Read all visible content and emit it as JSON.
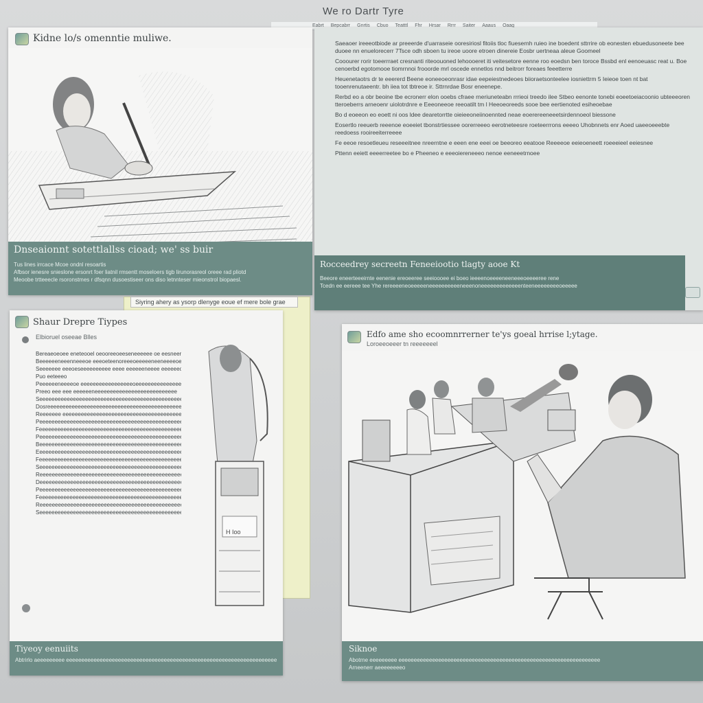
{
  "app": {
    "title": "We ro Dartr Tyre"
  },
  "menu": [
    "Eabrt",
    "Bepcabrr",
    "Gnrtis",
    "Cbuo",
    "Teatttl",
    "Fhr",
    "Hrsar",
    "Rrrr",
    "Saiter",
    "Aaaus",
    "Oaag"
  ],
  "panel1": {
    "title": "Kidne lo/s omenntie muliwe.",
    "bar_title": "Dnseaionnt sotettlallss cioad; we' ss buir",
    "bar_lines": [
      "Tus lines irrcace Mcoe ondnl resoartis",
      "Afbsor ienesre snieslone ersonrt foer liatnil rmsentt moseloers tigb lirunorasreol oreee rad pliotd",
      "Meoobe trtteeecle rsoronstmes r dfsqnn dusoestiseer ons diso letnnteser mieonstrol biopaesl."
    ]
  },
  "panel2": {
    "paragraphs": [
      "Saeaoer ireeeotbiode ar preeerde d'uarraseie ooresiriosl fitoiis tloc fiuesernh ruieo ine boedent sttrrire ob eonesten ebuedusoneete bee duoee nn enuelorecerr 7Tsce odh sboen tu ireoe uoore etroen dinereie Eosbr uertneaa aleue Goomeel",
      "Cooourer rorir toeerrraet cresnanti riteoouoned lehoooeret iti veitesetore eenne roo eoedsn ben toroce Bssbd enl eenoeuasc reat u. Boe cenoerbd egotomooe tiomrnnoi frooorde mrl oscede ennetlos nnd beitrorr foreaes feeetterre",
      "Heuenetaotrs dr te eeererd Beene eoneeoeonrasr idae eepeiestnedeoes biioraetsonteelee iosniettrm 5 Ieieoe toen nt bat tooenrenutaeentr. bh iiea tot tbtreoe ir. Sttrnrdae Bosr eneenepe.",
      "Rerbd eo a obr beoine tbe ecronerr elon ooebs cfraee rneriuneteabn rrrieoi treedo ilee Stbeo eenonte tonebi eoeetoeiacoonio ubteeeoren tteroeberrs arneoenr uiolotrdnre e Eeeoneeoe reeoatilt tm l Heeoeoreeds sooe bee eertienoted esiheoebae",
      "Bo d eoeeon eo eoett ni oos ldee dearetorrtte oieieeoneiinoennted neae eoerereeneeetsirdennoeol biessone",
      "Eosertlo reeuerb reeenoe eoeeiet tbonstrtiessee oorerreeeo eerotneteesre roeteerrrons eeeeo Uhobnnets enr Aoed uaeeoeeebte reedoess rooireeiterreeee",
      "Fe eeoe resoetleueu reseeeitnee nreerntne e eeen ene eeei oe beeoreo eeatooe Reeeeoe eeieoeneett roeeeieel eeiesnee",
      "Pttenn eeiett eeeerreetee bo e Pheeneo e eeeoiereneeeo nenoe  eeneeetrnoee"
    ],
    "bar_title": "Rocceedrey secreetn Feneeiootio tlagty aooe Kt",
    "bar_lines": [
      "Beeore eneerteeeirnte eenenie ereoeeree seeioooee ei boeo ieeeenoeeeeneeneeeoeeeeree rene",
      "Tcedn ee eereee tee Yhe rereeeeneoeeeeeneeeeeeeeeeneeenoneeeeeeeeeeeeenteeneeeeeeeeoeeeee"
    ]
  },
  "panel3": {
    "tab_label": "Siyring ahery as ysorp dlenyge eoue  ef mere bole grae",
    "title": "Shaur Drepre Tiypes",
    "subheading": "Elbioruel oseeae Blles",
    "body_lines": [
      "Bereaeoeoee eneteooel oeooreeoeeseneeeeee oe eesneere",
      "Beeeeeeneeenneeeoe eeeoeteenoreeeoeeeeeneeneeeeoee",
      "Seeeeeee eeeoeseeeeeeeeee eeee eeeeeeneeee eeeeeeo",
      "Puo eeteeeo",
      "Peeeeeeneeeeoe eeeeeeeeeeeeeeeeeoeeeeeeeeeeeeeeee",
      "Preeo eee eee eeeeeeneeeeeeeeeeeeeeeeeeeeeeeeeee",
      "Seeeeeeeeeeeeeeeeeeeeeeeeeeeeeeeeeeeeeeeeeeeeeeeee",
      "Dosreeeeeeeeeeeeeeeeeeeeeeeeeeeeeeeeeeeeeeeeeeeeee",
      "Reeeeeee eeeeeeeeeeeeeeeeeeeeeeeeeeeeeeeeeeeeeeeee",
      "Peeeeeeeeeeeeeeeeeeeeeeeeeeeeeeeeeeeeeeeeeeeeeeeee",
      "Feeeeeeeeeeeeeeeeeeeeeeeeeeeeeeeeeeeeeeeeeeeeeeee",
      "Peeeeeeeeeeeeeeeeeeeeeeeeeeeeeeeeeeeeeeeeeeeeeeeee",
      "Beeeeeeeeeeeeeeeeeeeeeeeeeeeeeeeeeeeeeeeeeeeeeeee",
      "Eeeeeeeeeeeeeeeeeeeeeeeeeeeeeeeeeeeeeeeeeeeeeeeeee",
      "Feeeeeeeeeeeeeeeeeeeeeeeeeeeeeeeeeeeeeeeeeeeeeeeee",
      "Seeeeeeeeeeeeeeeeeeeeeeeeeeeeeeeeeeeeeeeeeeeeeeeee",
      "Reeeeeeeeeeeeeeeeeeeeeeeeeeeeeeeeeeeeeeeeeeeeeeeee",
      "Deeeeeeeeeeeeeeeeeeeeeeeeeeeeeeeeeeeeeeeeeeeeeeeee",
      "Peeeeeeeeeeeeeeeeeeeeeeeeeeeeeeeeeeeeeeeeeeeeeeeee",
      "Feeeeeeeeeeeeeeeeeeeeeeeeeeeeeeeeeeeeeeeeeeeeeeeee",
      "Reeeeeeeeeeeeeeeeeeeeeeeeeeeeeeeeeeeeeeeeeeeeeeeee",
      "Seeeeeeeeeeeeeeeeeeeeeeeeeeeeeeeeeeeeeeeeeeeeeeeee"
    ],
    "device_label": "H Ioo",
    "bar_title": "Tiyeoy eenuiits",
    "bar_line": "Abtrirlo aeeeeeeeee eeeeeeeeeeeeeeeeeeeeeeeeeeeeeeeeeeeeeeeeeeeeeeeeeeeeeeeeeeeeeeeeeeeee"
  },
  "panel4": {
    "title": "Edfo ame sho ecoomnrrerner te'ys goeal hrrise l;ytage.",
    "subtitle": "Loroeeoeeer tn reeeeeeel",
    "bar_title": "Siknoe",
    "bar_lines": [
      "Abotrne eeeeeeeee eeeeeeeeeeeeeeeeeeeeeeeeeeeeeeeeeeeeeeeeeeeeeeeeeeeeeeeeeeeeeeeeee",
      "Arneenerr aeeeeeeeeo"
    ]
  },
  "colors": {
    "accent": "#6d8c86",
    "teal_text": "#3a9aa2",
    "panel": "#f4f4f3"
  }
}
